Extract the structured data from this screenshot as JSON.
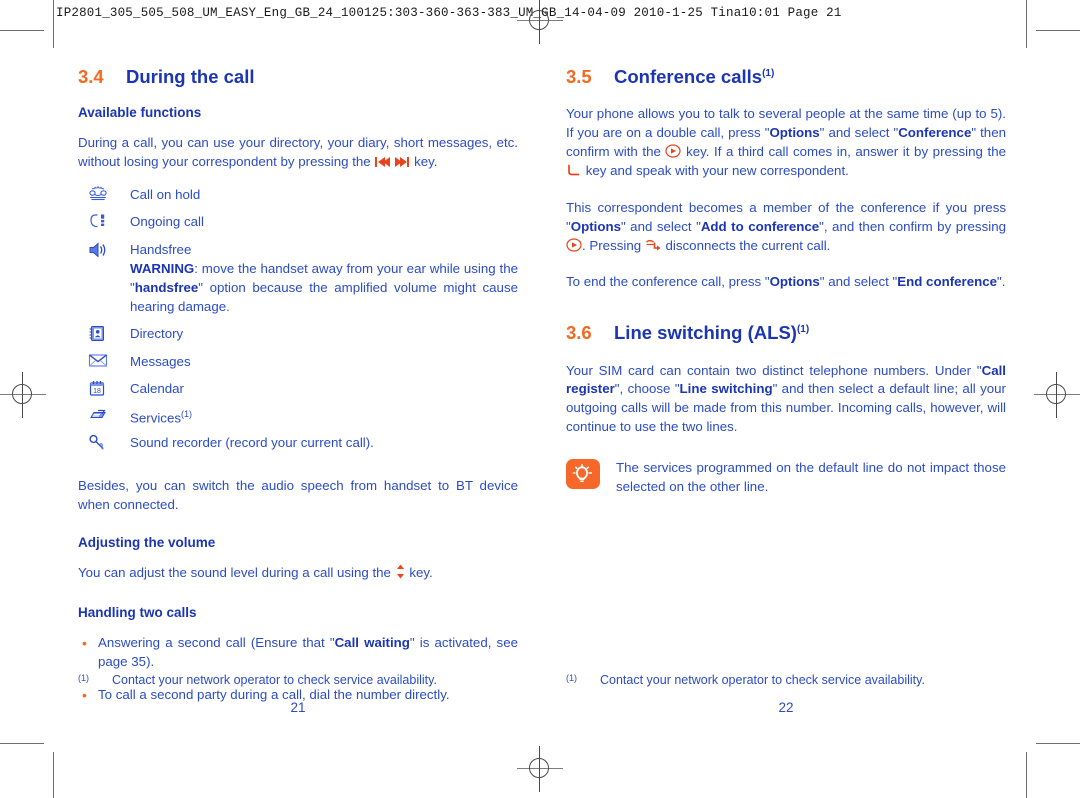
{
  "proof": {
    "header": "IP2801_305_505_508_UM_EASY_Eng_GB_24_100125:303-360-363-383_UM_GB_14-04-09  2010-1-25  Tina10:01  Page 21"
  },
  "colors": {
    "heading_blue": "#1b35b5",
    "body_blue": "#2b4cc8",
    "accent_orange": "#f26a21",
    "tip_badge": "#f5682a"
  },
  "left_column": {
    "section": {
      "number": "3.4",
      "title": "During the call",
      "superscript": ""
    },
    "subheading_1": "Available functions",
    "intro_part1": "During a call, you can use your directory, your diary, short messages, etc. without losing your correspondent by pressing the ",
    "intro_part2": " key.",
    "functions": [
      {
        "icon": "phone-on-hold-icon",
        "glyph": "☎",
        "label": "Call on hold"
      },
      {
        "icon": "ongoing-call-icon",
        "glyph": "☎",
        "label": "Ongoing call"
      },
      {
        "icon": "handsfree-speaker-icon",
        "glyph": "ὐA",
        "label": "Handsfree"
      },
      {
        "icon": "directory-icon",
        "glyph": "Ὅ2",
        "label": "Directory"
      },
      {
        "icon": "messages-envelope-icon",
        "glyph": "✉",
        "label": "Messages"
      },
      {
        "icon": "calendar-icon",
        "glyph": "18",
        "label": "Calendar"
      },
      {
        "icon": "services-icon",
        "glyph": "➤",
        "label": "Services",
        "superscript": "(1)"
      },
      {
        "icon": "sound-recorder-icon",
        "glyph": "♫",
        "label": "Sound recorder (record your current call)."
      }
    ],
    "warning": {
      "bold_word": "WARNING",
      "text_part1": ": move the handset away from your ear while using the \"",
      "bold_word2": "handsfree",
      "text_part2": "\" option because the amplified volume might cause hearing damage."
    },
    "besides_paragraph": "Besides, you can switch the audio speech from handset to BT device when connected.",
    "subheading_2": "Adjusting the volume",
    "volume_part1": "You can adjust the sound level during a call using the ",
    "volume_part2": " key.",
    "subheading_3": "Handling two calls",
    "bullets": [
      {
        "part1": "Answering a second call (Ensure that \"",
        "bold": "Call waiting",
        "part2": "\" is activated, see page 35)."
      },
      {
        "part1": "To call a second party during a call, dial the number directly.",
        "bold": "",
        "part2": ""
      }
    ],
    "footnote_mark": "(1)",
    "footnote_text": "Contact your network operator to check service availability.",
    "page_number": "21"
  },
  "right_column": {
    "section_1": {
      "number": "3.5",
      "title": "Conference calls",
      "superscript": "(1)"
    },
    "para_1": {
      "p1": "Your phone allows you to talk to several people at the same time (up to 5). If you are on a double call, press \"",
      "b1": "Options",
      "p2": "\" and select \"",
      "b2": "Conference",
      "p3": "\" then confirm with the ",
      "p4": " key. If a third call comes in, answer it by pressing the ",
      "p5": " key and speak with your new correspondent."
    },
    "para_2": {
      "p1": "This correspondent becomes a member of the conference if you press \"",
      "b1": "Options",
      "p2": "\" and select \"",
      "b2": "Add to conference",
      "p3": "\", and then confirm by pressing ",
      "p4": ". Pressing ",
      "p5": " disconnects the current call."
    },
    "para_3": {
      "p1": "To end the conference call, press \"",
      "b1": "Options",
      "p2": "\" and select \"",
      "b2": "End conference",
      "p3": "\"."
    },
    "section_2": {
      "number": "3.6",
      "title": "Line switching (ALS)",
      "superscript": "(1)"
    },
    "para_4": {
      "p1": "Your SIM card can contain two distinct telephone numbers. Under \"",
      "b1": "Call register",
      "p2": "\", choose \"",
      "b2": "Line switching",
      "p3": "\" and then select a default line; all your outgoing calls will be made from this number. Incoming calls, however, will continue to use the two lines."
    },
    "tip": {
      "icon": "tip-lightbulb-icon",
      "text": "The services programmed on the default line do not impact those selected on the other line."
    },
    "footnote_mark": "(1)",
    "footnote_text": "Contact your network operator to check service availability.",
    "page_number": "22"
  }
}
